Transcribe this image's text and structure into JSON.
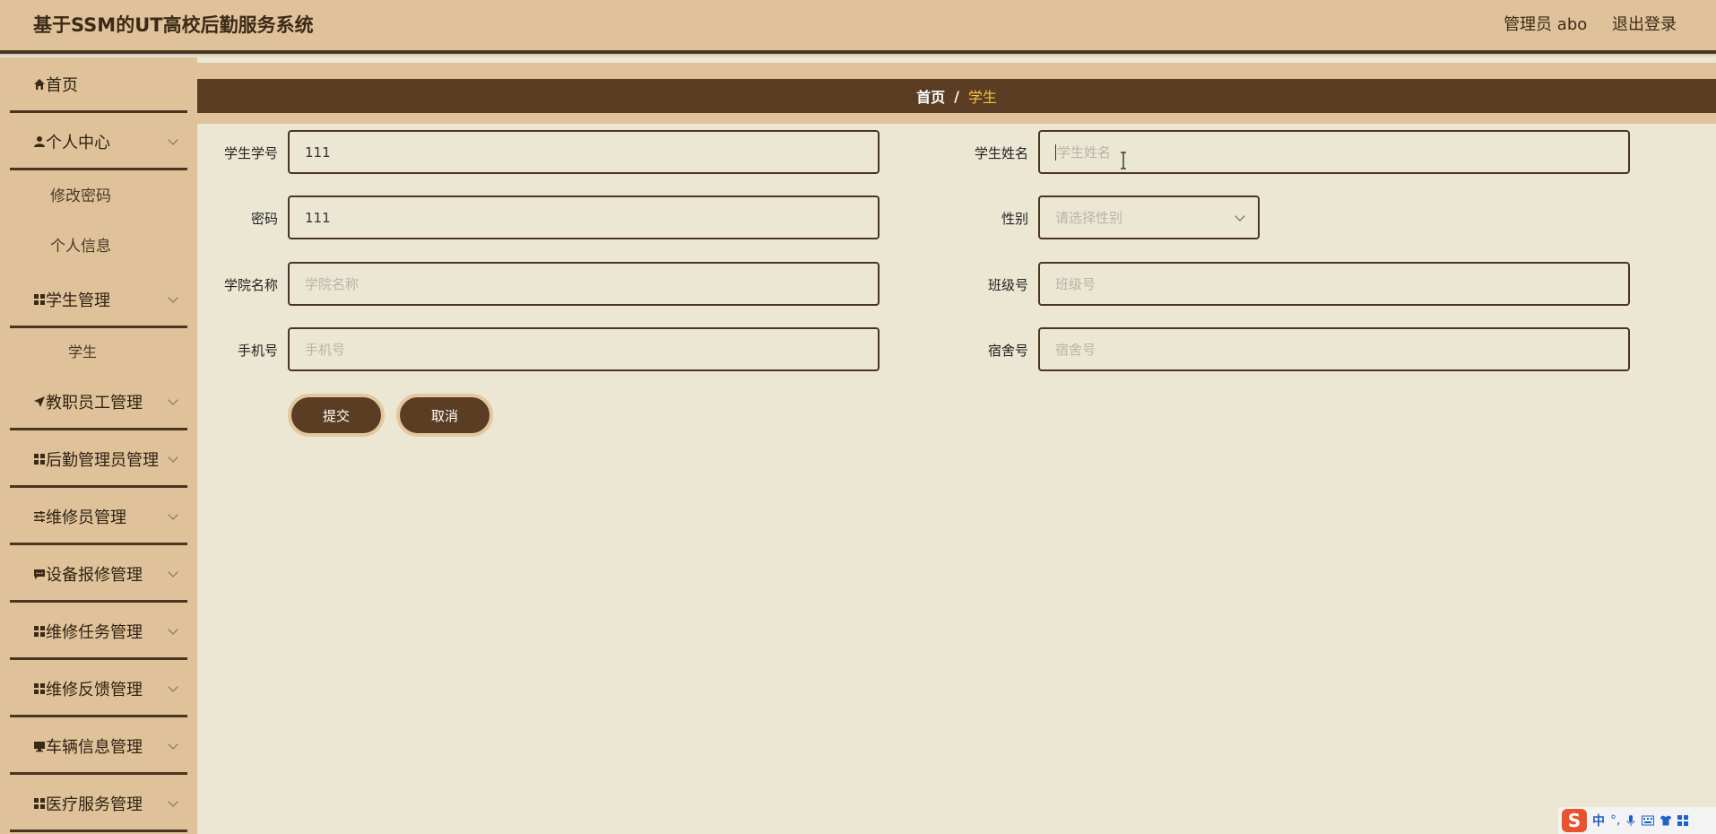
{
  "header": {
    "title": "基于SSM的UT高校后勤服务系统",
    "user": "管理员 abo",
    "logout": "退出登录"
  },
  "sidebar": {
    "items": [
      {
        "label": "首页",
        "icon": "home-icon"
      },
      {
        "label": "个人中心",
        "icon": "user-icon"
      },
      {
        "label": "学生管理",
        "icon": "grid-icon"
      },
      {
        "label": "教职员工管理",
        "icon": "send-icon"
      },
      {
        "label": "后勤管理员管理",
        "icon": "grid-icon"
      },
      {
        "label": "维修员管理",
        "icon": "sliders-icon"
      },
      {
        "label": "设备报修管理",
        "icon": "chat-icon"
      },
      {
        "label": "维修任务管理",
        "icon": "grid-icon"
      },
      {
        "label": "维修反馈管理",
        "icon": "grid-icon"
      },
      {
        "label": "车辆信息管理",
        "icon": "monitor-icon"
      },
      {
        "label": "医疗服务管理",
        "icon": "grid-icon"
      }
    ],
    "sub_personal": [
      "修改密码",
      "个人信息"
    ],
    "sub_student": [
      "学生"
    ]
  },
  "breadcrumb": {
    "home": "首页",
    "separator": "/",
    "current": "学生"
  },
  "form": {
    "student_no": {
      "label": "学生学号",
      "value": "111"
    },
    "student_name": {
      "label": "学生姓名",
      "placeholder": "学生姓名"
    },
    "password": {
      "label": "密码",
      "value": "111"
    },
    "gender": {
      "label": "性别",
      "placeholder": "请选择性别"
    },
    "college": {
      "label": "学院名称",
      "placeholder": "学院名称"
    },
    "class_no": {
      "label": "班级号",
      "placeholder": "班级号"
    },
    "phone": {
      "label": "手机号",
      "placeholder": "手机号"
    },
    "dorm": {
      "label": "宿舍号",
      "placeholder": "宿舍号"
    },
    "submit": "提交",
    "cancel": "取消"
  },
  "ime": {
    "logo": "S",
    "mode": "中"
  },
  "colors": {
    "header_bg": "#dfc29a",
    "dark_brown": "#5a3d22",
    "content_bg": "#ebe7d3",
    "accent_yellow": "#f6c343"
  }
}
